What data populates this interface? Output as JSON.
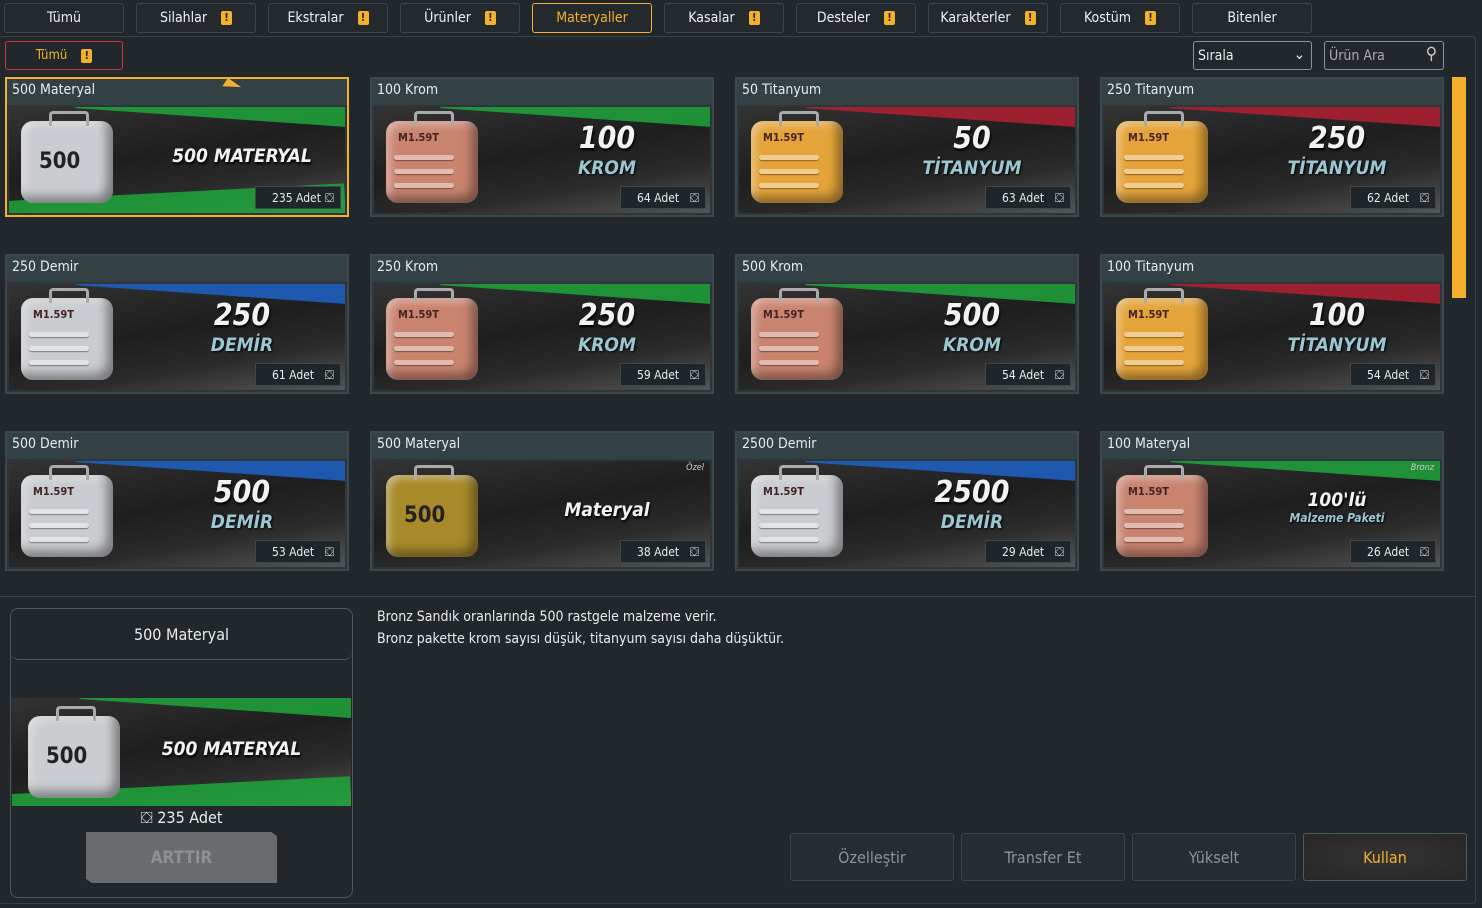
{
  "tabs": [
    {
      "label": "Tümü",
      "warn": false
    },
    {
      "label": "Silahlar",
      "warn": true
    },
    {
      "label": "Ekstralar",
      "warn": true
    },
    {
      "label": "Ürünler",
      "warn": true
    },
    {
      "label": "Materyaller",
      "warn": false,
      "active": true
    },
    {
      "label": "Kasalar",
      "warn": true
    },
    {
      "label": "Desteler",
      "warn": true
    },
    {
      "label": "Karakterler",
      "warn": true
    },
    {
      "label": "Kostüm",
      "warn": true
    },
    {
      "label": "Bitenler",
      "warn": false
    }
  ],
  "warn_glyph": "!",
  "filter": {
    "label": "Tümü"
  },
  "sort": {
    "label": "Sırala",
    "chevron": "⌄"
  },
  "search": {
    "placeholder": "Ürün Ara",
    "icon": "⚲"
  },
  "colors": {
    "accent": "#f3b02c",
    "green": "#1fa53a",
    "red": "#b32034",
    "blue": "#1f62c8",
    "silver": "#c9ccd0",
    "copper": "#c98470",
    "gold": "#e4a43a",
    "brass": "#a88a2a"
  },
  "box_icon": "⛋",
  "cards": [
    {
      "title": "500 Materyal",
      "big": "500 MATERYAL",
      "sub": "",
      "count": "235 Adet",
      "stripe": "green",
      "case": "silver",
      "case_text": "500",
      "style": "one",
      "selected": true
    },
    {
      "title": "100 Krom",
      "big": "100",
      "sub": "KROM",
      "count": "64 Adet",
      "stripe": "green",
      "case": "copper",
      "case_text": "M1.59T"
    },
    {
      "title": "50 Titanyum",
      "big": "50",
      "sub": "TİTANYUM",
      "count": "63 Adet",
      "stripe": "red",
      "case": "gold",
      "case_text": "M1.59T"
    },
    {
      "title": "250 Titanyum",
      "big": "250",
      "sub": "TİTANYUM",
      "count": "62 Adet",
      "stripe": "red",
      "case": "gold",
      "case_text": "M1.59T"
    },
    {
      "title": "250 Demir",
      "big": "250",
      "sub": "DEMİR",
      "count": "61 Adet",
      "stripe": "blue",
      "case": "silver",
      "case_text": "M1.59T"
    },
    {
      "title": "250 Krom",
      "big": "250",
      "sub": "KROM",
      "count": "59 Adet",
      "stripe": "green",
      "case": "copper",
      "case_text": "M1.59T"
    },
    {
      "title": "500 Krom",
      "big": "500",
      "sub": "KROM",
      "count": "54 Adet",
      "stripe": "green",
      "case": "copper",
      "case_text": "M1.59T"
    },
    {
      "title": "100 Titanyum",
      "big": "100",
      "sub": "TİTANYUM",
      "count": "54 Adet",
      "stripe": "red",
      "case": "gold",
      "case_text": "M1.59T"
    },
    {
      "title": "500 Demir",
      "big": "500",
      "sub": "DEMİR",
      "count": "53 Adet",
      "stripe": "blue",
      "case": "silver",
      "case_text": "M1.59T"
    },
    {
      "title": "500 Materyal",
      "big": "Materyal",
      "sub": "",
      "count": "38 Adet",
      "stripe": "none",
      "case": "brass",
      "case_text": "500",
      "style": "one",
      "tag": "Özel"
    },
    {
      "title": "2500 Demir",
      "big": "2500",
      "sub": "DEMİR",
      "count": "29 Adet",
      "stripe": "blue",
      "case": "silver",
      "case_text": "M1.59T"
    },
    {
      "title": "100 Materyal",
      "big": "100'lü",
      "sub": "Malzeme Paketi",
      "count": "26 Adet",
      "stripe": "green",
      "case": "copper",
      "case_text": "M1.59T",
      "tag": "Bronz",
      "style": "small"
    }
  ],
  "detail": {
    "title": "500 Materyal",
    "art_text": "500 MATERYAL",
    "case_text": "500",
    "count": "235 Adet",
    "button": "ARTTIR"
  },
  "description": [
    "Bronz Sandık oranlarında 500 rastgele malzeme verir.",
    "Bronz pakette krom sayısı düşük, titanyum sayısı daha düşüktür."
  ],
  "actions": [
    {
      "label": "Özelleştir"
    },
    {
      "label": "Transfer Et"
    },
    {
      "label": "Yükselt"
    },
    {
      "label": "Kullan",
      "primary": true
    }
  ]
}
